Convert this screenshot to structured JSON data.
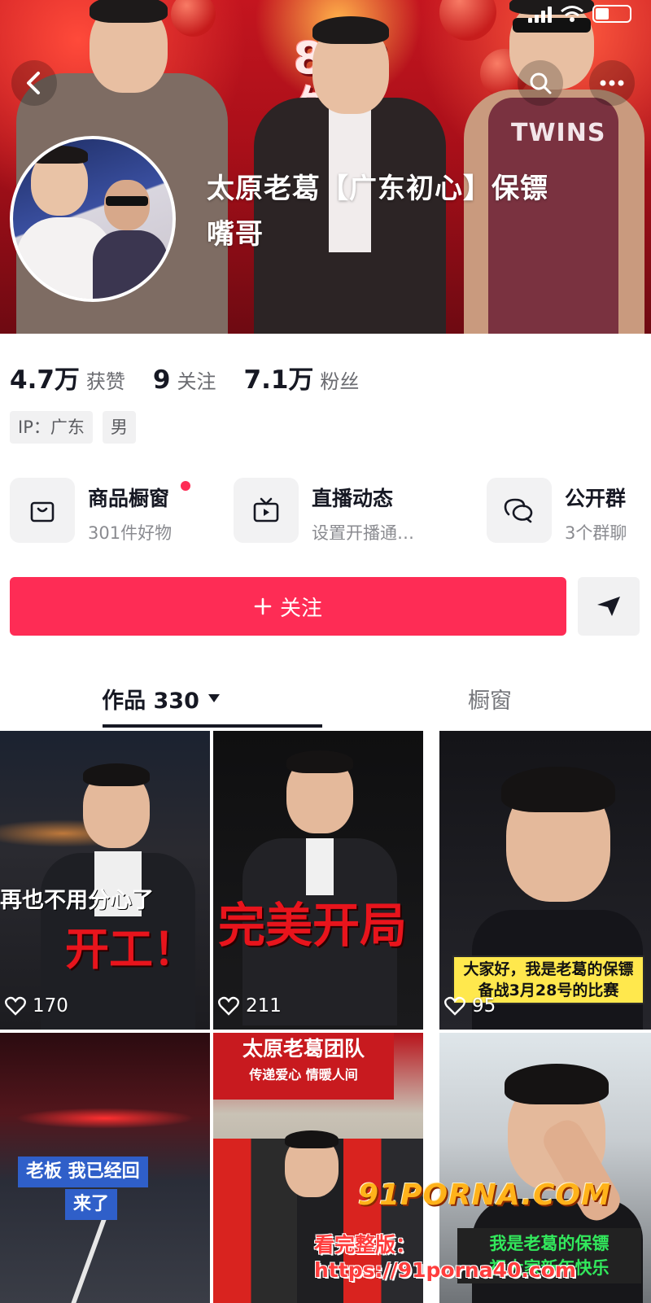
{
  "status_bar": {
    "icons": [
      "signal-icon",
      "wifi-icon",
      "battery-icon"
    ]
  },
  "header": {
    "banner_text_line1": "808",
    "banner_text_line2": "生日",
    "shirt_text": "TWINS",
    "name_line1": "太原老葛【广东初心】保镖",
    "name_line2": "嘴哥"
  },
  "stats": [
    {
      "value": "4.7万",
      "label": "获赞"
    },
    {
      "value": "9",
      "label": "关注"
    },
    {
      "value": "7.1万",
      "label": "粉丝"
    }
  ],
  "tags": [
    "IP：广东",
    "男"
  ],
  "features": [
    {
      "title": "商品橱窗",
      "subtitle": "301件好物",
      "icon": "bag-icon",
      "has_dot": true
    },
    {
      "title": "直播动态",
      "subtitle": "设置开播通…",
      "icon": "tv-icon",
      "has_dot": false
    },
    {
      "title": "公开群",
      "subtitle": "3个群聊",
      "icon": "chat-bubbles-icon",
      "has_dot": false
    }
  ],
  "follow": {
    "label": "关注",
    "icon": "plus-icon"
  },
  "share": {
    "icon": "send-icon"
  },
  "tabs": {
    "works_label": "作品 330",
    "shop_label": "橱窗"
  },
  "videos": [
    {
      "likes": "170",
      "caption_top": "再也不用分心了",
      "caption_big": "开工！"
    },
    {
      "likes": "211",
      "caption_big": "完美开局"
    },
    {
      "likes": "95",
      "caption_line1": "大家好，我是老葛的保镖",
      "caption_line2": "备战3月28号的比赛"
    },
    {
      "caption_line1": "老板 我已经回",
      "caption_line2": "来了"
    },
    {
      "banner_line1": "太原老葛团队",
      "banner_line2": "传递爱心 情暖人间"
    },
    {
      "caption_line1": "我是老葛的保镖",
      "caption_line2": "祝大家新年快乐"
    }
  ],
  "watermark": {
    "site": "91PORNA.COM",
    "url_line": "看完整版：https://91porna40.com"
  },
  "colors": {
    "accent": "#fe2c55",
    "text": "#161823",
    "muted": "#8a8b90"
  }
}
